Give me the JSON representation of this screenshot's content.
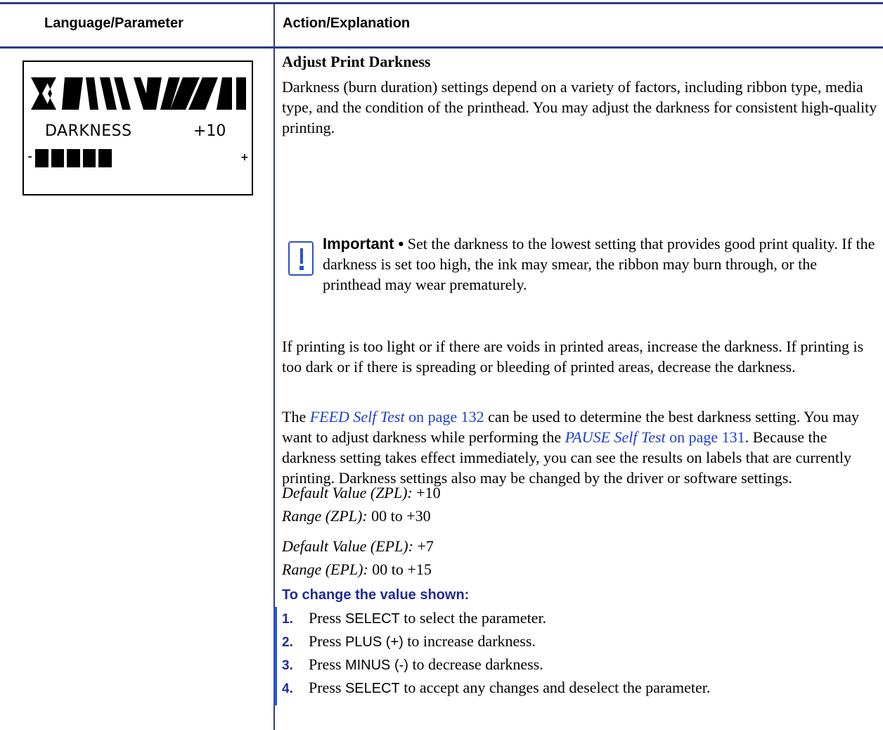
{
  "table_header": {
    "left": "Language/Parameter",
    "right": "Action/Explanation"
  },
  "lcd": {
    "label": "DARKNESS",
    "value": "+10",
    "minus": "-",
    "plus": "+",
    "bar_filled_fraction": 0.33,
    "bar_segments": 5
  },
  "section": {
    "title": "Adjust Print Darkness",
    "intro": "Darkness (burn duration) settings depend on a variety of factors, including ribbon type, media type, and the condition of the printhead. You may adjust the darkness for consistent high-quality printing.",
    "important_lead": "Important •",
    "important_text": " Set the darkness to the lowest setting that provides good print quality. If the darkness is set too high, the ink may smear, the ribbon may burn through, or the printhead may wear prematurely.",
    "para2": "If printing is too light or if there are voids in printed areas, increase the darkness. If printing is too dark or if there is spreading or bleeding of printed areas, decrease the darkness.",
    "para3_a": "The ",
    "link1_italic": "FEED Self Test",
    "link1_rest": " on page 132",
    "para3_b": " can be used to determine the best darkness setting. You may want to adjust darkness while performing the ",
    "link2_italic": "PAUSE Self Test",
    "link2_rest": " on page 131",
    "para3_c": ". Because the darkness setting takes effect immediately, you can see the results on labels that are currently printing. Darkness settings also may be changed by the driver or software settings."
  },
  "defaults": {
    "zpl_default_label": "Default Value (ZPL):",
    "zpl_default_value": " +10",
    "zpl_range_label": "Range (ZPL):",
    "zpl_range_value": " 00 to +30",
    "epl_default_label": "Default Value (EPL):",
    "epl_default_value": " +7",
    "epl_range_label": "Range (EPL):",
    "epl_range_value": " 00 to +15"
  },
  "procedure": {
    "title": "To change the value shown:",
    "steps": [
      {
        "num": "1.",
        "key": "SELECT",
        "pre": "Press ",
        "rest": " to select the parameter."
      },
      {
        "num": "2.",
        "key": "PLUS (+)",
        "pre": "Press ",
        "rest": " to increase darkness."
      },
      {
        "num": "3.",
        "key": "MINUS (-)",
        "pre": "Press ",
        "rest": " to decrease darkness."
      },
      {
        "num": "4.",
        "key": "SELECT",
        "pre": "Press ",
        "rest": " to accept any changes and deselect the parameter."
      }
    ]
  },
  "colors": {
    "rule": "#2a3a8c",
    "link": "#1a3fd1",
    "heading_blue": "#1f2a9a"
  }
}
